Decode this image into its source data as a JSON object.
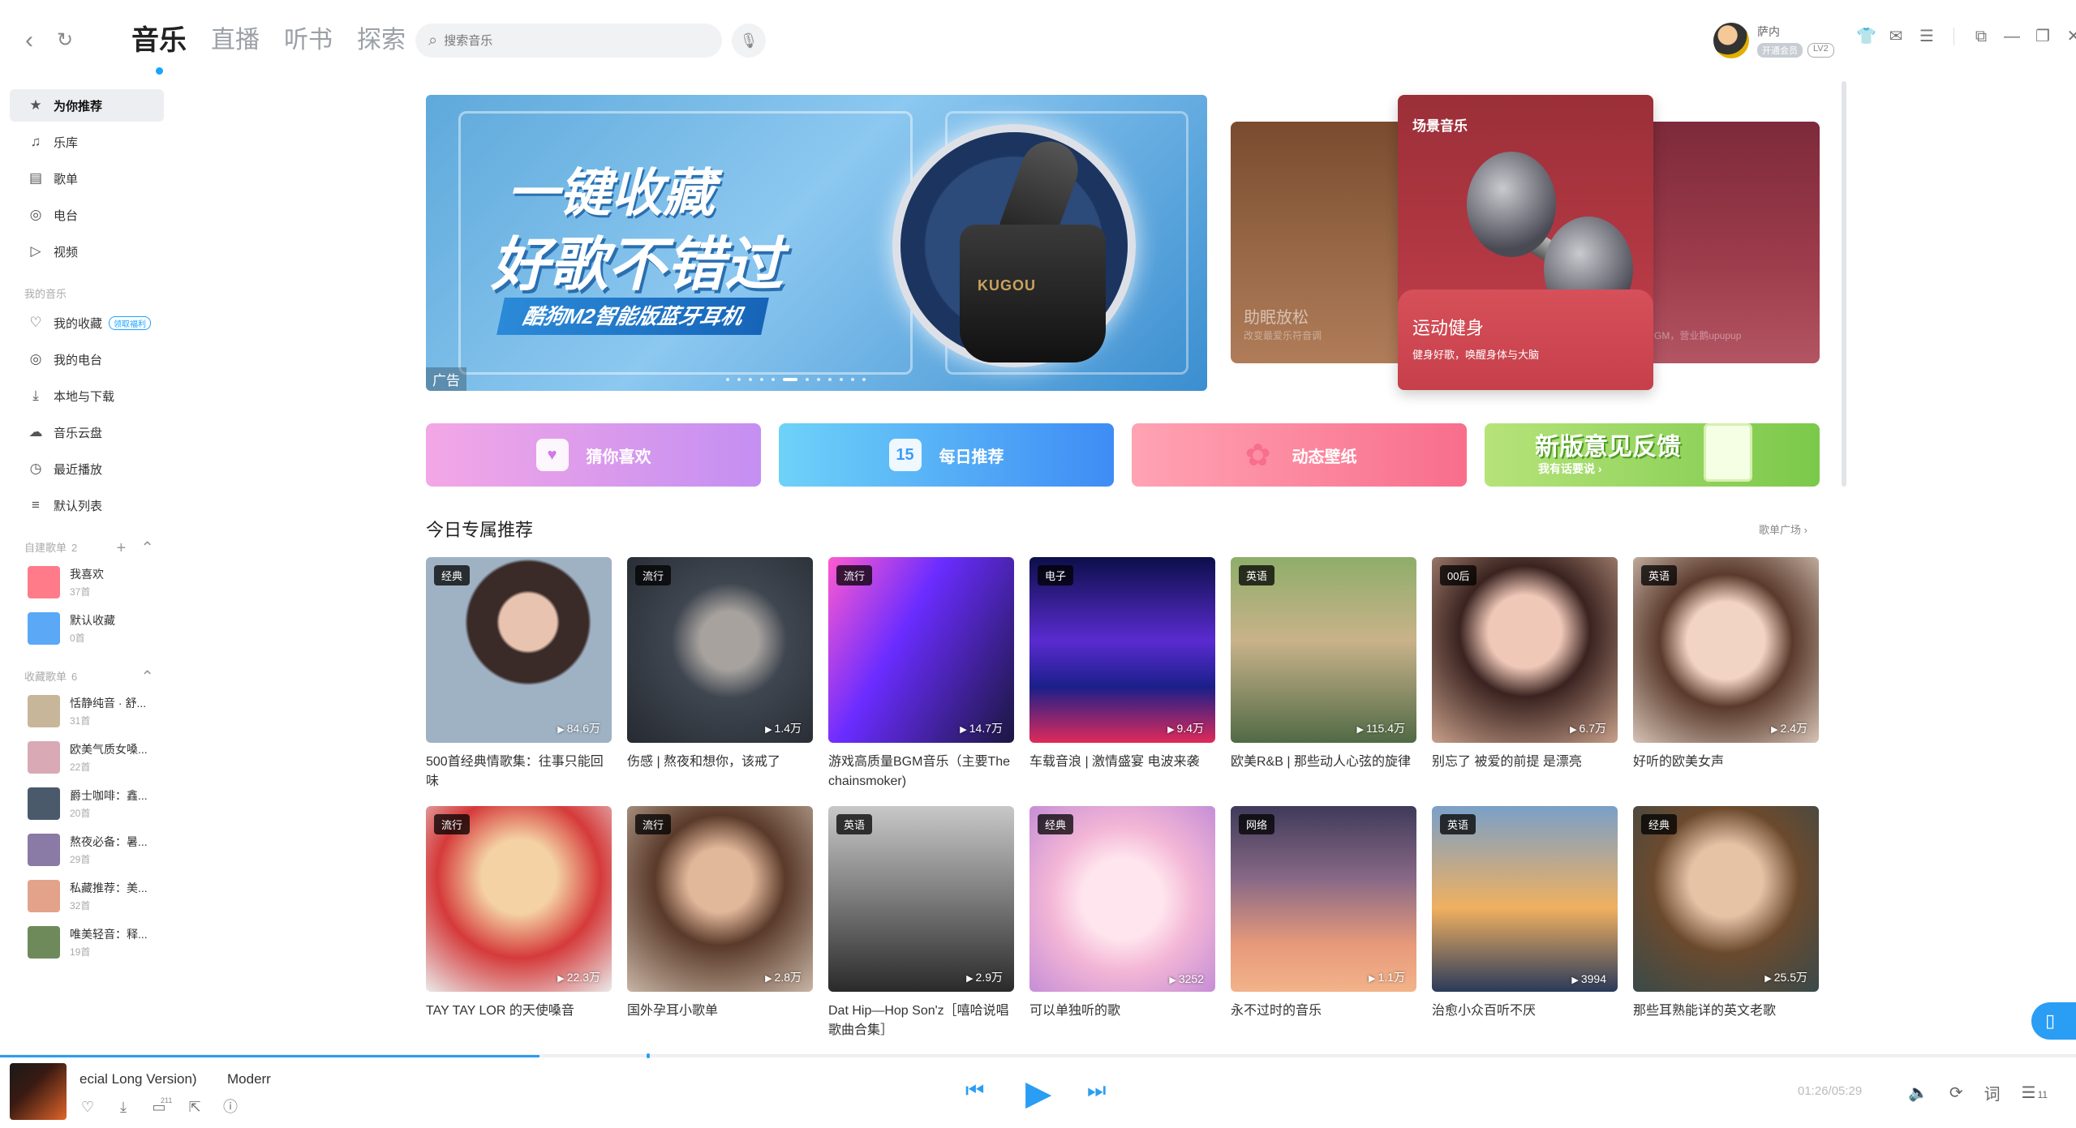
{
  "topbar": {
    "back_icon": "chevron-left-icon",
    "refresh_icon": "refresh-icon",
    "tabs": [
      {
        "label": "音乐",
        "active": true
      },
      {
        "label": "直播",
        "active": false
      },
      {
        "label": "听书",
        "active": false
      },
      {
        "label": "探索",
        "active": false
      }
    ],
    "search_placeholder": "搜索音乐",
    "user": {
      "name": "萨内",
      "vip_label": "开通会员",
      "level": "LV2"
    },
    "accent": "#1aa3ff"
  },
  "sidebar": {
    "nav": [
      {
        "label": "为你推荐",
        "icon": "recommend-icon",
        "active": true
      },
      {
        "label": "乐库",
        "icon": "library-icon"
      },
      {
        "label": "歌单",
        "icon": "playlist-icon"
      },
      {
        "label": "电台",
        "icon": "radio-icon"
      },
      {
        "label": "视频",
        "icon": "video-icon"
      }
    ],
    "my_music_title": "我的音乐",
    "my_music": [
      {
        "label": "我的收藏",
        "icon": "heart-icon",
        "tag": "领取福利"
      },
      {
        "label": "我的电台",
        "icon": "radio-icon"
      },
      {
        "label": "本地与下载",
        "icon": "download-icon"
      },
      {
        "label": "音乐云盘",
        "icon": "cloud-icon"
      },
      {
        "label": "最近播放",
        "icon": "clock-icon"
      },
      {
        "label": "默认列表",
        "icon": "list-icon"
      }
    ],
    "created_title": "自建歌单",
    "created_count": "2",
    "created": [
      {
        "title": "我喜欢",
        "count": "37首",
        "color": "#ff7b8a"
      },
      {
        "title": "默认收藏",
        "count": "0首",
        "color": "#5aa8f6"
      }
    ],
    "collected_title": "收藏歌单",
    "collected_count": "6",
    "collected": [
      {
        "title": "恬静纯音 · 舒...",
        "count": "31首",
        "color": "#c8b69a"
      },
      {
        "title": "欧美气质女嗓...",
        "count": "22首",
        "color": "#d9a9b6"
      },
      {
        "title": "爵士咖啡：鑫...",
        "count": "20首",
        "color": "#4a5a6a"
      },
      {
        "title": "熬夜必备：暑...",
        "count": "29首",
        "color": "#8a7aa6"
      },
      {
        "title": "私藏推荐：美...",
        "count": "32首",
        "color": "#e2a38a"
      },
      {
        "title": "唯美轻音：释...",
        "count": "19首",
        "color": "#6e8a5a"
      }
    ]
  },
  "banner": {
    "line1": "一键收藏",
    "line2": "好歌不错过",
    "tagline": "酷狗M2智能版蓝牙耳机",
    "product_logo": "KUGOU",
    "ad_label": "广告",
    "dot_count": 12,
    "active_dot": 5
  },
  "scenes": {
    "left": {
      "title": "助眠放松",
      "desc": "改变最爱乐符音调"
    },
    "main": {
      "header": "场景音乐",
      "title": "运动健身",
      "desc": "健身好歌，唤醒身体与大脑"
    },
    "right": {
      "desc": "GM，营业鹅upupup"
    }
  },
  "quick": [
    {
      "label": "猜你喜欢",
      "icon": "heart-box-icon",
      "glyph": "♥"
    },
    {
      "label": "每日推荐",
      "icon": "calendar-icon",
      "glyph": "15"
    },
    {
      "label": "动态壁纸",
      "icon": "pinwheel-icon",
      "glyph": "✿"
    },
    {
      "label": "新版意见反馈",
      "sub": "我有话要说 ›",
      "icon": "feedback-note-icon"
    }
  ],
  "section": {
    "title": "今日专属推荐",
    "more": "歌单广场 ›"
  },
  "cards": [
    {
      "tag": "经典",
      "plays": "84.6万",
      "title": "500首经典情歌集：往事只能回味"
    },
    {
      "tag": "流行",
      "plays": "1.4万",
      "title": "伤感 | 熬夜和想你，该戒了"
    },
    {
      "tag": "流行",
      "plays": "14.7万",
      "title": "游戏高质量BGM音乐（主要The chainsmoker)"
    },
    {
      "tag": "电子",
      "plays": "9.4万",
      "title": "车载音浪 | 激情盛宴 电波来袭"
    },
    {
      "tag": "英语",
      "plays": "115.4万",
      "title": "欧美R&B | 那些动人心弦的旋律"
    },
    {
      "tag": "00后",
      "plays": "6.7万",
      "title": "别忘了 被爱的前提 是漂亮"
    },
    {
      "tag": "英语",
      "plays": "2.4万",
      "title": "好听的欧美女声"
    },
    {
      "tag": "流行",
      "plays": "22.3万",
      "title": "TAY TAY LOR 的天使嗓音"
    },
    {
      "tag": "流行",
      "plays": "2.8万",
      "title": "国外孕耳小歌单"
    },
    {
      "tag": "英语",
      "plays": "2.9万",
      "title": "Dat Hip—Hop Son'z［嘻哈说唱歌曲合集］"
    },
    {
      "tag": "经典",
      "plays": "3252",
      "title": "可以单独听的歌"
    },
    {
      "tag": "网络",
      "plays": "1.1万",
      "title": "永不过时的音乐"
    },
    {
      "tag": "英语",
      "plays": "3994",
      "title": "治愈小众百听不厌"
    },
    {
      "tag": "经典",
      "plays": "25.5万",
      "title": "那些耳熟能详的英文老歌"
    }
  ],
  "player": {
    "now_playing_title": "ecial Long Version)",
    "artist": "Moderr",
    "comment_count": "211",
    "time": "01:26/05:29",
    "progress": 0.26,
    "queue_count": "11",
    "lyrics_label": "词"
  }
}
